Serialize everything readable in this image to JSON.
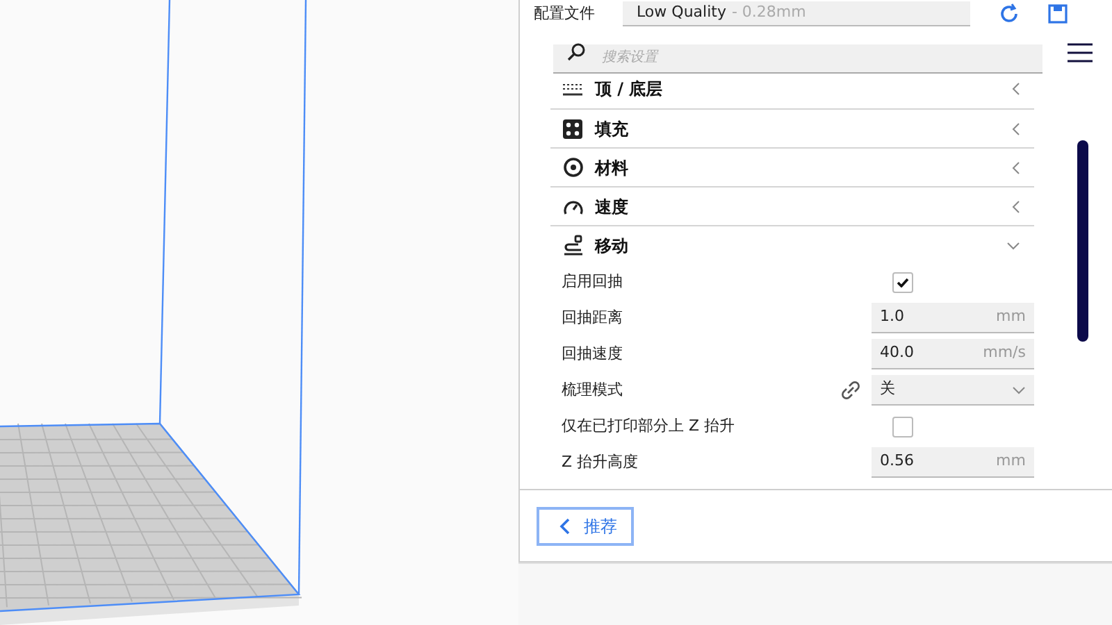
{
  "profile": {
    "label": "配置文件",
    "value": "Low Quality",
    "detail": "- 0.28mm"
  },
  "search": {
    "placeholder": "搜索设置"
  },
  "sections": [
    {
      "kind": "layers",
      "label": "顶 / 底层",
      "expanded": false
    },
    {
      "kind": "infill",
      "label": "填充",
      "expanded": false
    },
    {
      "kind": "material",
      "label": "材料",
      "expanded": false
    },
    {
      "kind": "speed",
      "label": "速度",
      "expanded": false
    },
    {
      "kind": "travel",
      "label": "移动",
      "expanded": true
    }
  ],
  "settings": [
    {
      "kind": "checkbox",
      "label": "启用回抽",
      "checked": true
    },
    {
      "kind": "number",
      "label": "回抽距离",
      "value": "1.0",
      "unit": "mm"
    },
    {
      "kind": "number",
      "label": "回抽速度",
      "value": "40.0",
      "unit": "mm/s"
    },
    {
      "kind": "select",
      "label": "梳理模式",
      "value": "关",
      "linked": true
    },
    {
      "kind": "checkbox",
      "label": "仅在已打印部分上 Z 抬升",
      "checked": false
    },
    {
      "kind": "number",
      "label": "Z 抬升高度",
      "value": "0.56",
      "unit": "mm"
    }
  ],
  "recommended_button": {
    "label": "推荐"
  }
}
